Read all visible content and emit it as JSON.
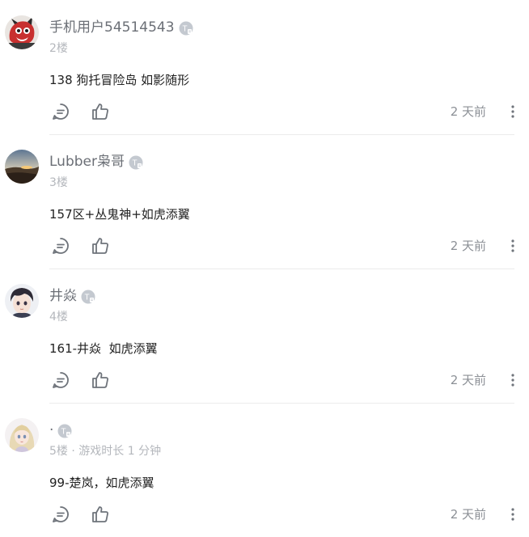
{
  "colors": {
    "username": "#6b6f76",
    "meta": "#b4b7bc",
    "body": "#222222",
    "time": "#8c9096",
    "divider": "#ececec",
    "icon": "#6f747b",
    "badge": "#c4c9d0"
  },
  "comments": [
    {
      "username": "手机用户54514543",
      "meta": "2楼",
      "text": "138 狗托冒险岛 如影随形",
      "time": "2 天前",
      "avatar_icon": "red-creature-avatar",
      "badge_icon": "t-level-badge-icon"
    },
    {
      "username": "Lubber枭哥",
      "meta": "3楼",
      "text": "157区+丛鬼神+如虎添翼",
      "time": "2 天前",
      "avatar_icon": "sunset-landscape-avatar",
      "badge_icon": "t-level-badge-icon"
    },
    {
      "username": "井焱",
      "meta": "4楼",
      "text": "161-井焱  如虎添翼",
      "time": "2 天前",
      "avatar_icon": "anime-boy-avatar",
      "badge_icon": "t-level-badge-icon"
    },
    {
      "username": "·",
      "meta": "5楼 · 游戏时长 1 分钟",
      "text": "99-楚岚，如虎添翼",
      "time": "2 天前",
      "avatar_icon": "anime-girl-avatar",
      "badge_icon": "t-level-badge-icon"
    }
  ]
}
